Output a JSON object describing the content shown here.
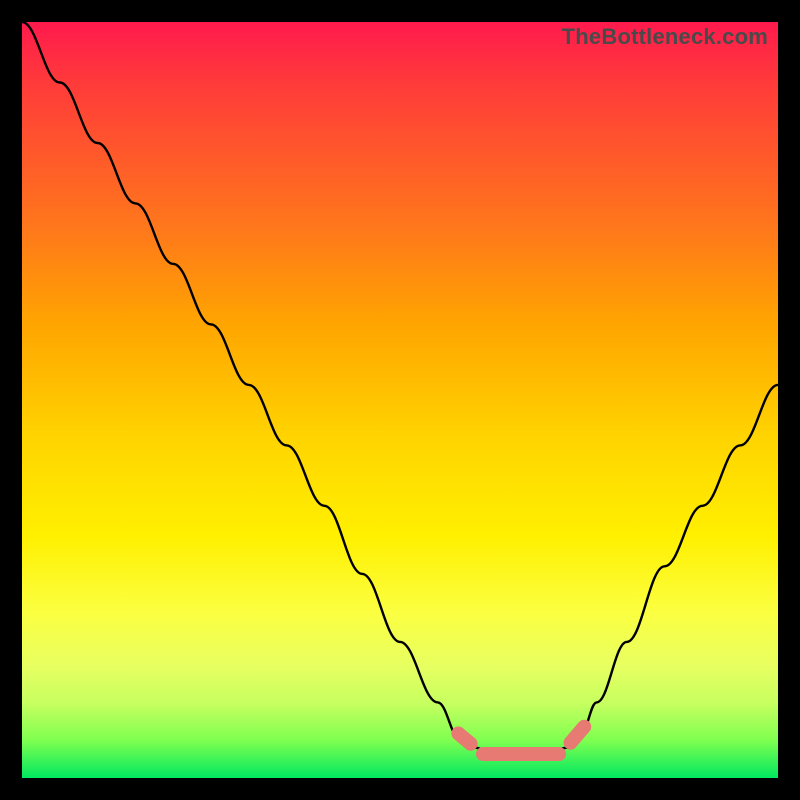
{
  "watermark": "TheBottleneck.com",
  "colors": {
    "background": "#000000",
    "curve": "#000000",
    "marker": "#e77a72",
    "gradient_top": "#ff1a4d",
    "gradient_bottom": "#00e860"
  },
  "chart_data": {
    "type": "line",
    "title": "",
    "xlabel": "",
    "ylabel": "",
    "xlim": [
      0,
      100
    ],
    "ylim": [
      0,
      100
    ],
    "grid": false,
    "legend": false,
    "series": [
      {
        "name": "bottleneck-curve",
        "x": [
          0,
          5,
          10,
          15,
          20,
          25,
          30,
          35,
          40,
          45,
          50,
          55,
          58,
          60,
          62,
          65,
          68,
          70,
          72,
          74,
          76,
          80,
          85,
          90,
          95,
          100
        ],
        "values": [
          100,
          92,
          84,
          76,
          68,
          60,
          52,
          44,
          36,
          27,
          18,
          10,
          5,
          4,
          3.5,
          3.2,
          3.2,
          3.5,
          4,
          6,
          10,
          18,
          28,
          36,
          44,
          52
        ]
      }
    ],
    "markers": [
      {
        "x0": 57,
        "y0": 6.5,
        "x1": 60,
        "y1": 4.0
      },
      {
        "x0": 60,
        "y0": 3.2,
        "x1": 72,
        "y1": 3.2
      },
      {
        "x0": 72,
        "y0": 4.0,
        "x1": 75,
        "y1": 7.5
      }
    ],
    "annotations": []
  }
}
